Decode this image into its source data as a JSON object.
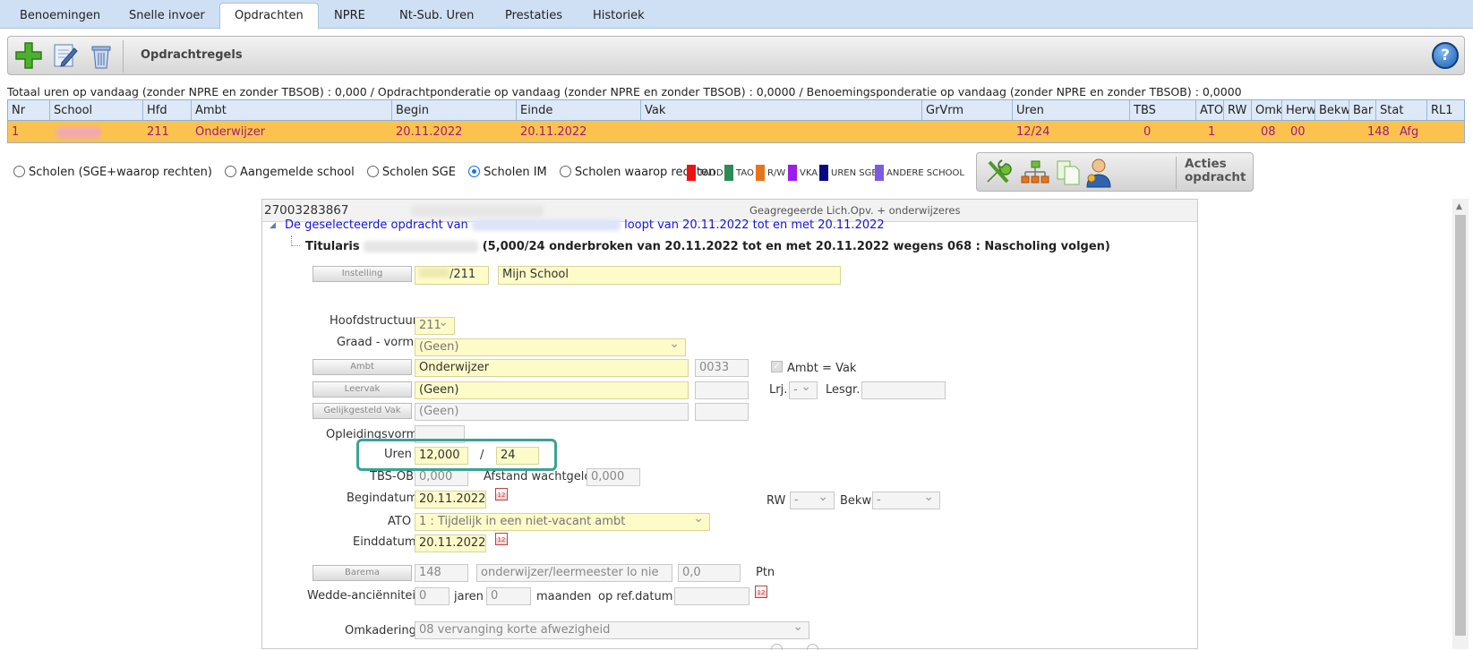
{
  "tabs": [
    "Benoemingen",
    "Snelle invoer",
    "Opdrachten",
    "NPRE",
    "Nt-Sub. Uren",
    "Prestaties",
    "Historiek"
  ],
  "active_tab": "Opdrachten",
  "toolbar": {
    "title": "Opdrachtregels",
    "help": "?"
  },
  "summary": "Totaal uren op vandaag (zonder NPRE en zonder TBSOB) : 0,000 / Opdrachtponderatie op vandaag (zonder NPRE en zonder TBSOB) : 0,0000 / Benoemingsponderatie op vandaag (zonder NPRE en zonder TBSOB) : 0,0000",
  "grid": {
    "columns": [
      "Nr",
      "School",
      "Hfd",
      "Ambt",
      "Begin",
      "Einde",
      "Vak",
      "GrVrm",
      "Uren",
      "TBS",
      "ATO",
      "RW",
      "Omk",
      "Herw",
      "Bekw",
      "Bar",
      "Stat",
      "RL1"
    ],
    "row": {
      "nr": "1",
      "hfd": "211",
      "ambt": "Onderwijzer",
      "begin": "20.11.2022",
      "einde": "20.11.2022",
      "uren": "12/24",
      "tbs": "0",
      "ato": "1",
      "omk": "08",
      "herw": "00",
      "bar": "148",
      "stat": "Afg"
    }
  },
  "radios": [
    "Scholen (SGE+waarop rechten)",
    "Aangemelde school",
    "Scholen SGE",
    "Scholen IM",
    "Scholen waarop rechten"
  ],
  "radio_selected": "Scholen IM",
  "legend": [
    {
      "label": "TADD",
      "color": "#ee1111"
    },
    {
      "label": "TAO",
      "color": "#2e8b57"
    },
    {
      "label": "R/W",
      "color": "#e8741a"
    },
    {
      "label": "VKA",
      "color": "#9b1de8"
    },
    {
      "label": "UREN SGE",
      "color": "#0a0a80"
    },
    {
      "label": "ANDERE SCHOOL",
      "color": "#7a5ce0"
    }
  ],
  "acties": {
    "line1": "Acties",
    "line2": "opdracht"
  },
  "panel": {
    "id": "27003283867",
    "subtitle": "Geagregeerde Lich.Opv. + onderwijzeres",
    "tree1_a": "De geselecteerde opdracht van",
    "tree1_b": "loopt van 20.11.2022 tot en met 20.11.2022",
    "tree2_a": "Titularis",
    "tree2_b": "(5,000/24 onderbroken van 20.11.2022 tot en met 20.11.2022 wegens 068 : Nascholing volgen)",
    "btn_instelling": "Instelling",
    "instelling_code": "/211",
    "instelling_name": "Mijn School",
    "lbl_hoofdstructuur": "Hoofdstructuur",
    "hoofdstructuur": "211",
    "lbl_graad": "Graad - vorm",
    "graad": "(Geen)",
    "btn_ambt": "Ambt",
    "ambt": "Onderwijzer",
    "ambt_code": "0033",
    "ambt_vak": "Ambt = Vak",
    "btn_leervak": "Leervak",
    "leervak": "(Geen)",
    "lbl_lrj": "Lrj.",
    "lrj": "-",
    "lbl_lesgr": "Lesgr.",
    "btn_gelijk": "Gelijkgesteld Vak",
    "gelijk": "(Geen)",
    "lbl_opleiding": "Opleidingsvorm",
    "lbl_uren": "Uren",
    "uren": "12,000",
    "uren_slash": "/",
    "uren_of": "24",
    "lbl_tbs": "TBS-OB",
    "tbs": "0,000",
    "lbl_afstand": "Afstand wachtgeld",
    "afstand": "0,000",
    "lbl_begindatum": "Begindatum",
    "begindatum": "20.11.2022",
    "lbl_rw": "RW",
    "rw": "-",
    "lbl_bekw": "Bekw",
    "bekw": "-",
    "lbl_ato": "ATO",
    "ato": "1 : Tijdelijk in een niet-vacant ambt",
    "lbl_einddatum": "Einddatum",
    "einddatum": "20.11.2022",
    "btn_barema": "Barema",
    "barema": "148",
    "barema_desc": "onderwijzer/leermeester lo nie",
    "barema_ptn": "0,0",
    "lbl_ptn": "Ptn",
    "lbl_wedde": "Wedde-anciënniteit",
    "jaren": "0",
    "lbl_jaren": "jaren",
    "maanden": "0",
    "lbl_maanden": "maanden",
    "lbl_refdatum": "op ref.datum",
    "lbl_omkadering": "Omkadering",
    "omkadering": "08 vervanging korte afwezigheid"
  }
}
